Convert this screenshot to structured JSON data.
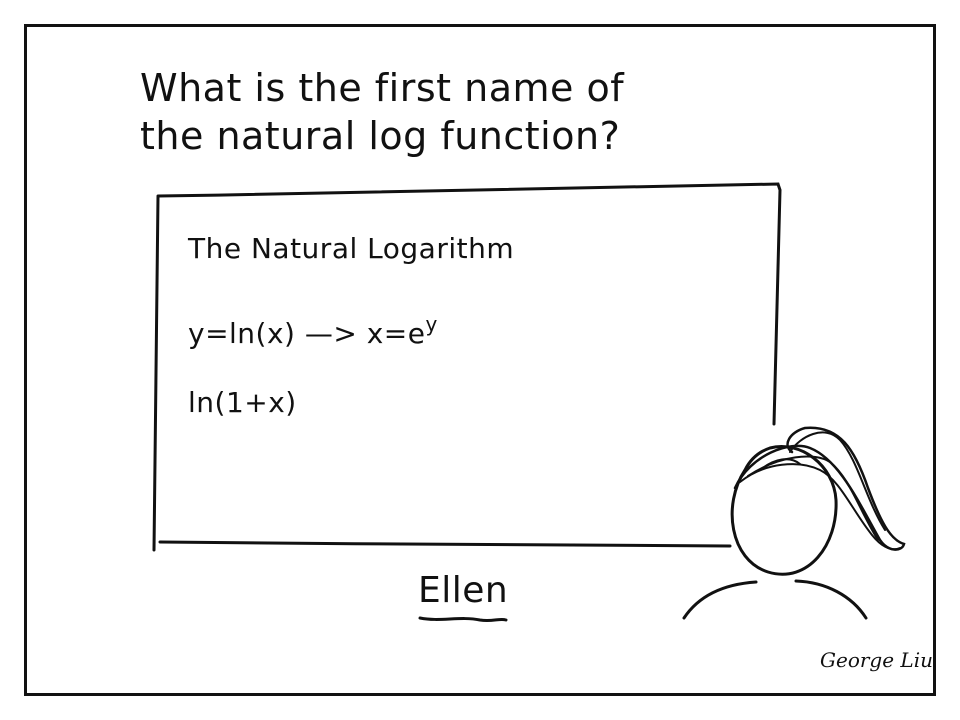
{
  "question": {
    "line1": "What is the first name of",
    "line2": "the natural log function?"
  },
  "whiteboard": {
    "title": "The Natural Logarithm",
    "equation_main": "y=ln(x) —> x=e",
    "equation_exponent": "y",
    "expression": "ln(1+x)"
  },
  "caption": "Ellen",
  "signature": "George Liu",
  "colors": {
    "ink": "#111111",
    "background": "#ffffff"
  }
}
